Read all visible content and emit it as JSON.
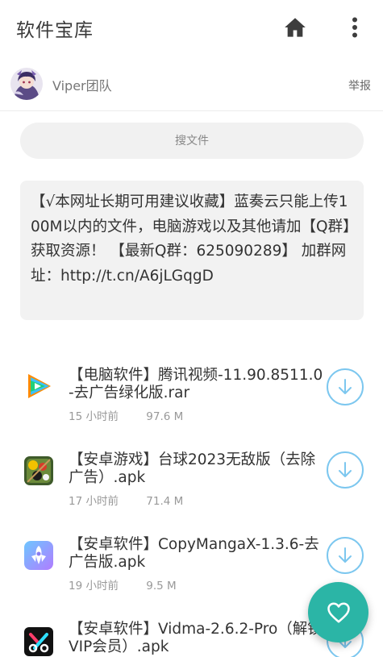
{
  "appbar": {
    "title": "软件宝库",
    "home_icon": "home-icon",
    "more_icon": "more-vertical-icon"
  },
  "user": {
    "name": "Viper团队",
    "report_label": "举报",
    "avatar_icon": "avatar-image"
  },
  "search": {
    "placeholder": "搜文件",
    "value": ""
  },
  "notice": {
    "text": "【√本网址长期可用建议收藏】蓝奏云只能上传100M以内的文件，电脑游戏以及其他请加【Q群】获取资源！ 【最新Q群：625090289】 加群网址：http://t.cn/A6jLGqgD"
  },
  "files": [
    {
      "name": "【电脑软件】腾讯视频-11.90.8511.0-去广告绿化版.rar",
      "time": "15 小时前",
      "size": "97.6 M",
      "icon": "tencent-video-icon"
    },
    {
      "name": "【安卓游戏】台球2023无敌版（去除广告）.apk",
      "time": "17 小时前",
      "size": "71.4 M",
      "icon": "billiards-icon"
    },
    {
      "name": "【安卓软件】CopyMangaX-1.3.6-去广告版.apk",
      "time": "19 小时前",
      "size": "9.5 M",
      "icon": "copymanga-icon"
    },
    {
      "name": "【安卓软件】Vidma-2.6.2-Pro（解锁VIP会员）.apk",
      "time": "",
      "size": "",
      "icon": "vidma-icon"
    }
  ],
  "colors": {
    "accent": "#2bb5a6",
    "download_ring": "#7cc7ef",
    "notice_bg": "#f2f2f2"
  },
  "fab": {
    "icon": "heart-icon"
  }
}
